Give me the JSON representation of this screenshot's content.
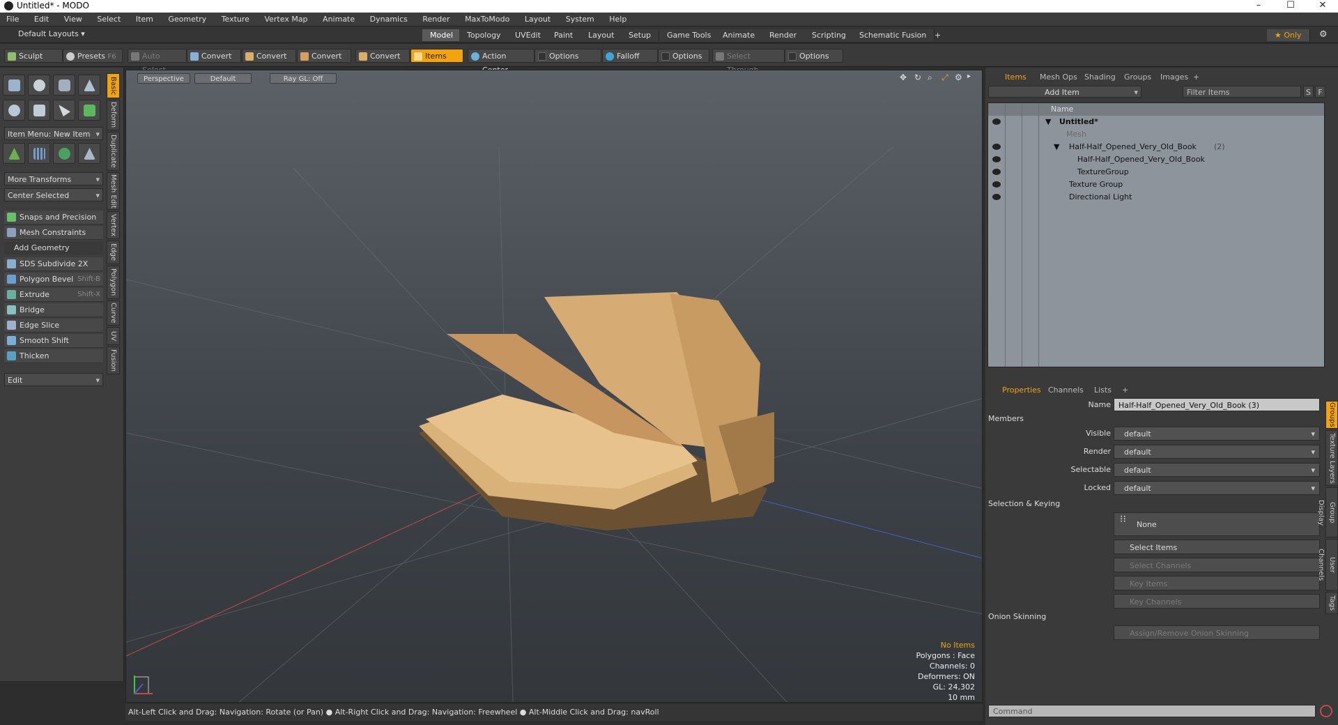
{
  "window": {
    "title": "Untitled* - MODO",
    "minimize": "–",
    "maximize": "☐",
    "close": "✕"
  },
  "menu": [
    "File",
    "Edit",
    "View",
    "Select",
    "Item",
    "Geometry",
    "Texture",
    "Vertex Map",
    "Animate",
    "Dynamics",
    "Render",
    "MaxToModo",
    "Layout",
    "System",
    "Help"
  ],
  "layouts": {
    "label": "Default Layouts ▾",
    "tabs": [
      "Model",
      "Topology",
      "UVEdit",
      "Paint",
      "Layout",
      "Setup",
      "Game Tools",
      "Animate",
      "Render",
      "Scripting",
      "Schematic Fusion"
    ],
    "active": "Model",
    "add": "+",
    "only": "★  Only"
  },
  "toolbar": {
    "sculpt": "Sculpt",
    "presets": "Presets",
    "presets_key": "F6",
    "auto_select": "Auto Select",
    "convert": "Convert",
    "items": "Items",
    "action_center": "Action Center",
    "options": "Options",
    "falloff": "Falloff",
    "select_through": "Select Through"
  },
  "left": {
    "item_menu": "Item Menu: New Item",
    "more_transforms": "More Transforms",
    "center_selected": "Center Selected",
    "snaps": "Snaps and Precision",
    "mesh_constraints": "Mesh Constraints",
    "add_geometry": "Add Geometry",
    "tools": [
      {
        "label": "SDS Subdivide 2X",
        "key": ""
      },
      {
        "label": "Polygon Bevel",
        "key": "Shift-B"
      },
      {
        "label": "Extrude",
        "key": "Shift-X"
      },
      {
        "label": "Bridge",
        "key": ""
      },
      {
        "label": "Edge Slice",
        "key": ""
      },
      {
        "label": "Smooth Shift",
        "key": ""
      },
      {
        "label": "Thicken",
        "key": ""
      }
    ],
    "edit": "Edit",
    "vtabs": [
      "Basic",
      "Deform",
      "Duplicate",
      "Mesh Edit",
      "Vertex",
      "Edge",
      "Polygon",
      "Curve",
      "UV",
      "Fusion"
    ]
  },
  "viewport": {
    "perspective": "Perspective",
    "default": "Default",
    "raygl": "Ray GL: Off",
    "info": {
      "no_items": "No Items",
      "polygons": "Polygons : Face",
      "channels": "Channels: 0",
      "deformers": "Deformers: ON",
      "gl": "GL: 24,302",
      "unit": "10 mm"
    }
  },
  "status": "Alt-Left Click and Drag: Navigation: Rotate (or Pan) ● Alt-Right Click and Drag: Navigation: Freewheel ● Alt-Middle Click and Drag: navRoll",
  "items_panel": {
    "tabs": [
      "Items",
      "Mesh Ops",
      "Shading",
      "Groups",
      "Images",
      "+"
    ],
    "add_item": "Add Item",
    "filter": "Filter Items",
    "s": "S",
    "f": "F",
    "col_name": "Name",
    "rows": [
      {
        "label": "Untitled*"
      },
      {
        "label": "Mesh"
      },
      {
        "label": "Half-Half_Opened_Very_Old_Book",
        "count": "(2)"
      },
      {
        "label": "Half-Half_Opened_Very_Old_Book"
      },
      {
        "label": "TextureGroup"
      },
      {
        "label": "Texture Group"
      },
      {
        "label": "Directional Light"
      }
    ]
  },
  "properties": {
    "tabs": [
      "Properties",
      "Channels",
      "Lists",
      "+"
    ],
    "name_label": "Name",
    "name_value": "Half-Half_Opened_Very_Old_Book (3)",
    "members": "Members",
    "visible": "Visible",
    "render": "Render",
    "selectable": "Selectable",
    "locked": "Locked",
    "default": "default",
    "selection_keying": "Selection & Keying",
    "none": "None",
    "select_items": "Select Items",
    "select_channels": "Select Channels",
    "key_items": "Key Items",
    "key_channels": "Key Channels",
    "onion": "Onion Skinning",
    "assign_onion": "Assign/Remove Onion Skinning",
    "vtabs": [
      "Groups",
      "Texture Layers",
      "Group Display",
      "User Channels",
      "Tags"
    ]
  },
  "command": {
    "placeholder": "Command"
  },
  "colors": {
    "accent": "#f3a30c",
    "book": "#d9b27a"
  }
}
